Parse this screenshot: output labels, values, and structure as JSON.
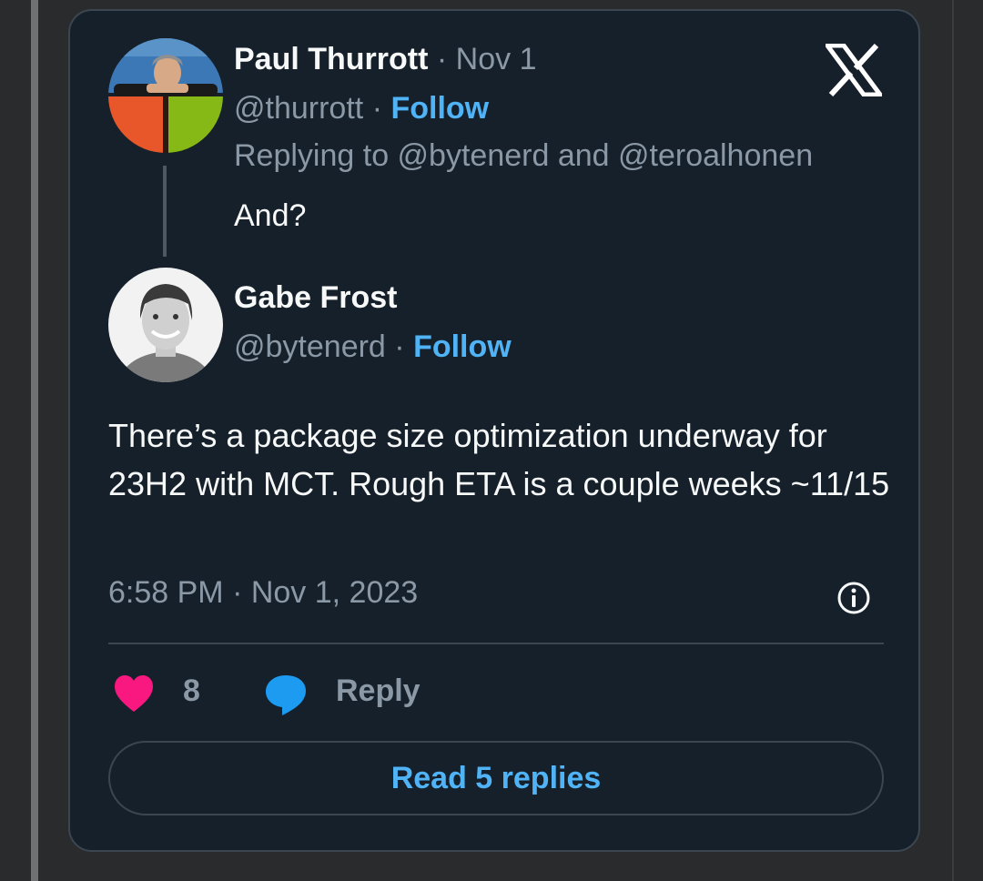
{
  "parent_tweet": {
    "author_name": "Paul Thurrott",
    "date": "Nov 1",
    "handle": "@thurrott",
    "follow_label": "Follow",
    "replying_to": "Replying to @bytenerd and @teroalhonen",
    "text": "And?"
  },
  "main_tweet": {
    "author_name": "Gabe Frost",
    "handle": "@bytenerd",
    "follow_label": "Follow",
    "text": "There’s a package size optimization underway for 23H2 with MCT. Rough ETA is a couple weeks ~11/15",
    "timestamp": "6:58 PM · Nov 1, 2023"
  },
  "actions": {
    "like_count": "8",
    "reply_label": "Reply"
  },
  "read_replies_label": "Read 5 replies",
  "separator": "·",
  "icons": [
    "x-logo-icon",
    "heart-icon",
    "reply-bubble-icon",
    "info-icon"
  ],
  "colors": {
    "card_bg": "#15202b",
    "accent": "#4fb3f6",
    "heart": "#f91880",
    "bubble": "#1d9bf0",
    "muted": "#8b98a5"
  }
}
